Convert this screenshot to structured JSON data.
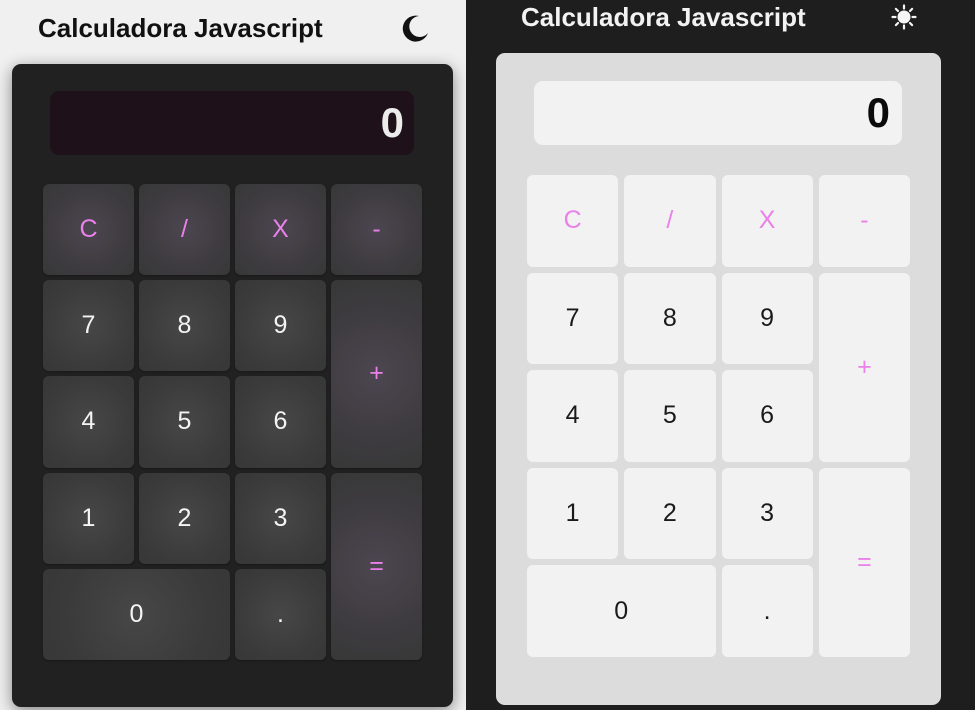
{
  "dark_view": {
    "title": "Calculadora Javascript",
    "toggle_icon": "moon-icon",
    "display": "0",
    "keys": {
      "clear": "C",
      "divide": "/",
      "multiply": "X",
      "subtract": "-",
      "seven": "7",
      "eight": "8",
      "nine": "9",
      "add": "+",
      "four": "4",
      "five": "5",
      "six": "6",
      "one": "1",
      "two": "2",
      "three": "3",
      "equals": "=",
      "zero": "0",
      "decimal": "."
    }
  },
  "light_view": {
    "title": "Calculadora Javascript",
    "toggle_icon": "sun-icon",
    "display": "0",
    "keys": {
      "clear": "C",
      "divide": "/",
      "multiply": "X",
      "subtract": "-",
      "seven": "7",
      "eight": "8",
      "nine": "9",
      "add": "+",
      "four": "4",
      "five": "5",
      "six": "6",
      "one": "1",
      "two": "2",
      "three": "3",
      "equals": "=",
      "zero": "0",
      "decimal": "."
    }
  },
  "colors": {
    "operator_accent": "#ea80ea",
    "dark_calc_body": "#212121",
    "dark_display_bg": "#1e1119",
    "light_calc_body": "#dcdcdc",
    "light_key_bg": "#f2f2f2"
  }
}
